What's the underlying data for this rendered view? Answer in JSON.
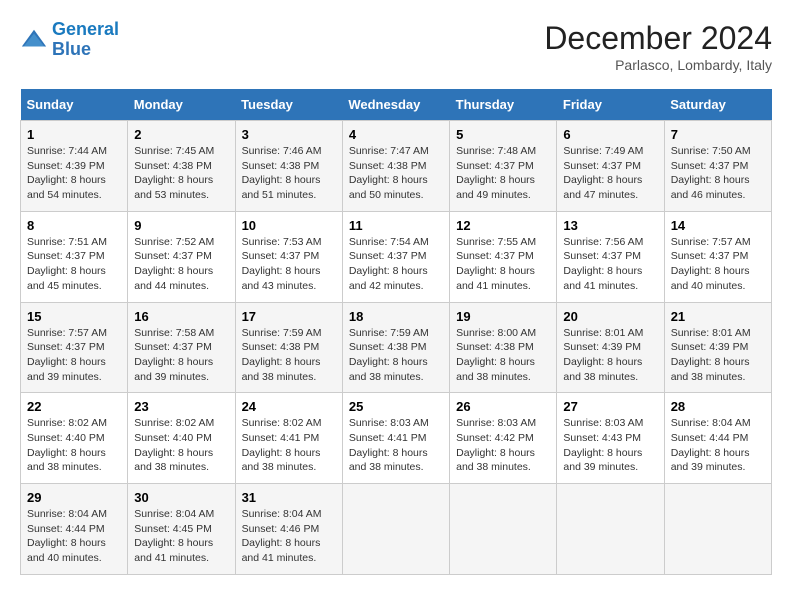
{
  "header": {
    "logo_line1": "General",
    "logo_line2": "Blue",
    "month": "December 2024",
    "location": "Parlasco, Lombardy, Italy"
  },
  "weekdays": [
    "Sunday",
    "Monday",
    "Tuesday",
    "Wednesday",
    "Thursday",
    "Friday",
    "Saturday"
  ],
  "weeks": [
    [
      {
        "day": "1",
        "sunrise": "Sunrise: 7:44 AM",
        "sunset": "Sunset: 4:39 PM",
        "daylight": "Daylight: 8 hours and 54 minutes."
      },
      {
        "day": "2",
        "sunrise": "Sunrise: 7:45 AM",
        "sunset": "Sunset: 4:38 PM",
        "daylight": "Daylight: 8 hours and 53 minutes."
      },
      {
        "day": "3",
        "sunrise": "Sunrise: 7:46 AM",
        "sunset": "Sunset: 4:38 PM",
        "daylight": "Daylight: 8 hours and 51 minutes."
      },
      {
        "day": "4",
        "sunrise": "Sunrise: 7:47 AM",
        "sunset": "Sunset: 4:38 PM",
        "daylight": "Daylight: 8 hours and 50 minutes."
      },
      {
        "day": "5",
        "sunrise": "Sunrise: 7:48 AM",
        "sunset": "Sunset: 4:37 PM",
        "daylight": "Daylight: 8 hours and 49 minutes."
      },
      {
        "day": "6",
        "sunrise": "Sunrise: 7:49 AM",
        "sunset": "Sunset: 4:37 PM",
        "daylight": "Daylight: 8 hours and 47 minutes."
      },
      {
        "day": "7",
        "sunrise": "Sunrise: 7:50 AM",
        "sunset": "Sunset: 4:37 PM",
        "daylight": "Daylight: 8 hours and 46 minutes."
      }
    ],
    [
      {
        "day": "8",
        "sunrise": "Sunrise: 7:51 AM",
        "sunset": "Sunset: 4:37 PM",
        "daylight": "Daylight: 8 hours and 45 minutes."
      },
      {
        "day": "9",
        "sunrise": "Sunrise: 7:52 AM",
        "sunset": "Sunset: 4:37 PM",
        "daylight": "Daylight: 8 hours and 44 minutes."
      },
      {
        "day": "10",
        "sunrise": "Sunrise: 7:53 AM",
        "sunset": "Sunset: 4:37 PM",
        "daylight": "Daylight: 8 hours and 43 minutes."
      },
      {
        "day": "11",
        "sunrise": "Sunrise: 7:54 AM",
        "sunset": "Sunset: 4:37 PM",
        "daylight": "Daylight: 8 hours and 42 minutes."
      },
      {
        "day": "12",
        "sunrise": "Sunrise: 7:55 AM",
        "sunset": "Sunset: 4:37 PM",
        "daylight": "Daylight: 8 hours and 41 minutes."
      },
      {
        "day": "13",
        "sunrise": "Sunrise: 7:56 AM",
        "sunset": "Sunset: 4:37 PM",
        "daylight": "Daylight: 8 hours and 41 minutes."
      },
      {
        "day": "14",
        "sunrise": "Sunrise: 7:57 AM",
        "sunset": "Sunset: 4:37 PM",
        "daylight": "Daylight: 8 hours and 40 minutes."
      }
    ],
    [
      {
        "day": "15",
        "sunrise": "Sunrise: 7:57 AM",
        "sunset": "Sunset: 4:37 PM",
        "daylight": "Daylight: 8 hours and 39 minutes."
      },
      {
        "day": "16",
        "sunrise": "Sunrise: 7:58 AM",
        "sunset": "Sunset: 4:37 PM",
        "daylight": "Daylight: 8 hours and 39 minutes."
      },
      {
        "day": "17",
        "sunrise": "Sunrise: 7:59 AM",
        "sunset": "Sunset: 4:38 PM",
        "daylight": "Daylight: 8 hours and 38 minutes."
      },
      {
        "day": "18",
        "sunrise": "Sunrise: 7:59 AM",
        "sunset": "Sunset: 4:38 PM",
        "daylight": "Daylight: 8 hours and 38 minutes."
      },
      {
        "day": "19",
        "sunrise": "Sunrise: 8:00 AM",
        "sunset": "Sunset: 4:38 PM",
        "daylight": "Daylight: 8 hours and 38 minutes."
      },
      {
        "day": "20",
        "sunrise": "Sunrise: 8:01 AM",
        "sunset": "Sunset: 4:39 PM",
        "daylight": "Daylight: 8 hours and 38 minutes."
      },
      {
        "day": "21",
        "sunrise": "Sunrise: 8:01 AM",
        "sunset": "Sunset: 4:39 PM",
        "daylight": "Daylight: 8 hours and 38 minutes."
      }
    ],
    [
      {
        "day": "22",
        "sunrise": "Sunrise: 8:02 AM",
        "sunset": "Sunset: 4:40 PM",
        "daylight": "Daylight: 8 hours and 38 minutes."
      },
      {
        "day": "23",
        "sunrise": "Sunrise: 8:02 AM",
        "sunset": "Sunset: 4:40 PM",
        "daylight": "Daylight: 8 hours and 38 minutes."
      },
      {
        "day": "24",
        "sunrise": "Sunrise: 8:02 AM",
        "sunset": "Sunset: 4:41 PM",
        "daylight": "Daylight: 8 hours and 38 minutes."
      },
      {
        "day": "25",
        "sunrise": "Sunrise: 8:03 AM",
        "sunset": "Sunset: 4:41 PM",
        "daylight": "Daylight: 8 hours and 38 minutes."
      },
      {
        "day": "26",
        "sunrise": "Sunrise: 8:03 AM",
        "sunset": "Sunset: 4:42 PM",
        "daylight": "Daylight: 8 hours and 38 minutes."
      },
      {
        "day": "27",
        "sunrise": "Sunrise: 8:03 AM",
        "sunset": "Sunset: 4:43 PM",
        "daylight": "Daylight: 8 hours and 39 minutes."
      },
      {
        "day": "28",
        "sunrise": "Sunrise: 8:04 AM",
        "sunset": "Sunset: 4:44 PM",
        "daylight": "Daylight: 8 hours and 39 minutes."
      }
    ],
    [
      {
        "day": "29",
        "sunrise": "Sunrise: 8:04 AM",
        "sunset": "Sunset: 4:44 PM",
        "daylight": "Daylight: 8 hours and 40 minutes."
      },
      {
        "day": "30",
        "sunrise": "Sunrise: 8:04 AM",
        "sunset": "Sunset: 4:45 PM",
        "daylight": "Daylight: 8 hours and 41 minutes."
      },
      {
        "day": "31",
        "sunrise": "Sunrise: 8:04 AM",
        "sunset": "Sunset: 4:46 PM",
        "daylight": "Daylight: 8 hours and 41 minutes."
      },
      null,
      null,
      null,
      null
    ]
  ]
}
